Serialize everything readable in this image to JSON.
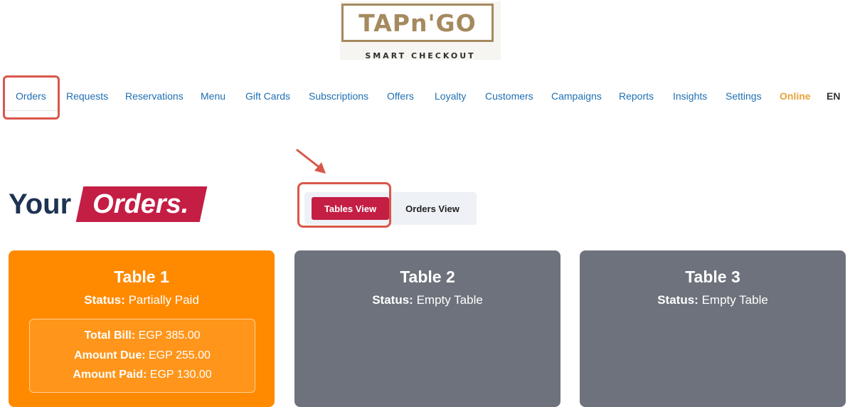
{
  "brand": {
    "logo_word": "TAPn'GO",
    "tagline": "SMART CHECKOUT"
  },
  "nav": {
    "items": [
      {
        "label": "Orders"
      },
      {
        "label": "Requests"
      },
      {
        "label": "Reservations"
      },
      {
        "label": "Menu"
      },
      {
        "label": "Gift Cards"
      },
      {
        "label": "Subscriptions"
      },
      {
        "label": "Offers"
      },
      {
        "label": "Loyalty"
      },
      {
        "label": "Customers"
      },
      {
        "label": "Campaigns"
      },
      {
        "label": "Reports"
      },
      {
        "label": "Insights"
      },
      {
        "label": "Settings"
      }
    ],
    "status": "Online",
    "language": "EN"
  },
  "heading": {
    "prefix": "Your",
    "highlight": "Orders."
  },
  "view_toggle": {
    "tables_view": "Tables View",
    "orders_view": "Orders View"
  },
  "tables": [
    {
      "name": "Table 1",
      "status_label": "Status:",
      "status": "Partially Paid",
      "total_label": "Total Bill:",
      "total": "EGP 385.00",
      "due_label": "Amount Due:",
      "due": "EGP 255.00",
      "paid_label": "Amount Paid:",
      "paid": "EGP 130.00"
    },
    {
      "name": "Table 2",
      "status_label": "Status:",
      "status": "Empty Table"
    },
    {
      "name": "Table 3",
      "status_label": "Status:",
      "status": "Empty Table"
    }
  ],
  "colors": {
    "accent": "#c41e45",
    "nav_link": "#1f6fb2",
    "online": "#e8a33a",
    "occupied_card": "#ff8a00",
    "empty_card": "#6d727c",
    "heading": "#1e3352",
    "annotation": "#d9574a"
  }
}
